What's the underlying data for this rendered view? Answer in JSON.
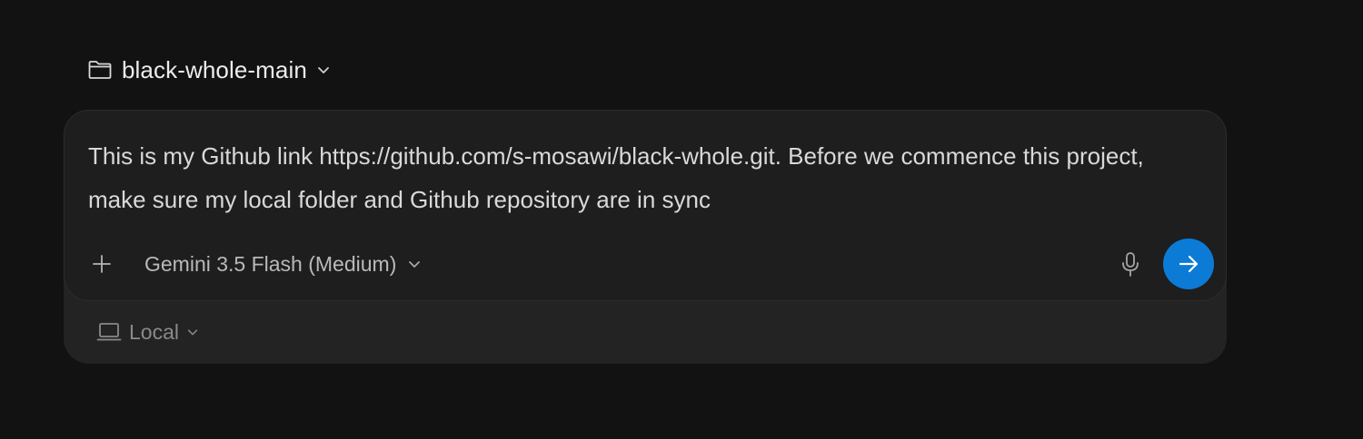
{
  "workspace": {
    "folder_name": "black-whole-main",
    "folder_icon": "folder-icon",
    "dropdown_icon": "chevron-down-icon"
  },
  "composer": {
    "prompt": "This is my Github link https://github.com/s-mosawi/black-whole.git. Before we commence this project, make sure my local folder and Github repository are in sync",
    "add_icon": "plus-icon",
    "model": {
      "label": "Gemini 3.5 Flash (Medium)",
      "dropdown_icon": "chevron-down-icon"
    },
    "mic_icon": "microphone-icon",
    "send_icon": "arrow-right-icon",
    "send_color": "#0b7bd6"
  },
  "environment": {
    "label": "Local",
    "icon": "laptop-icon",
    "dropdown_icon": "chevron-down-icon"
  }
}
